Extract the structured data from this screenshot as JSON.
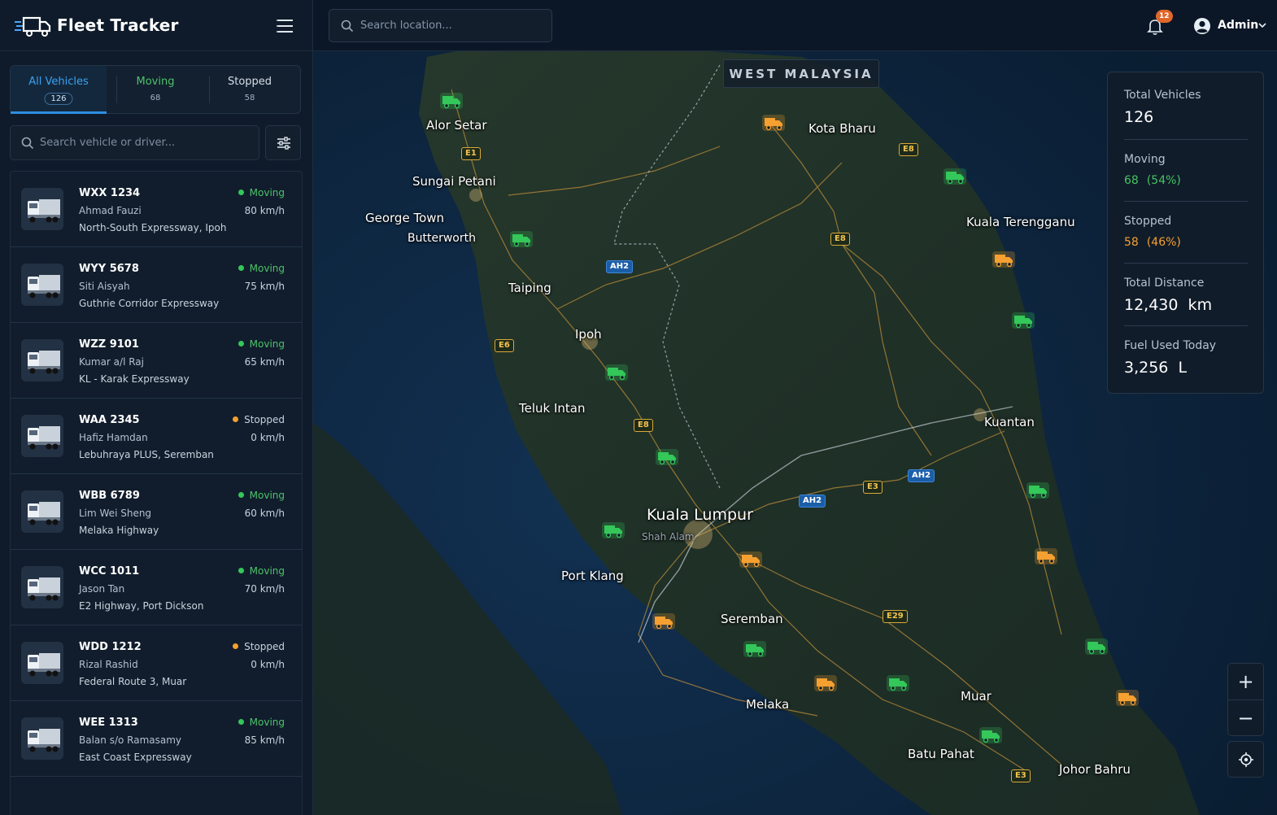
{
  "app": {
    "title": "Fleet Tracker"
  },
  "tabs": [
    {
      "label": "All Vehicles",
      "count": "126"
    },
    {
      "label": "Moving",
      "count": "68"
    },
    {
      "label": "Stopped",
      "count": "58"
    }
  ],
  "vehicle_search": {
    "placeholder": "Search vehicle or driver..."
  },
  "vehicles": [
    {
      "plate": "WXX 1234",
      "driver": "Ahmad Fauzi",
      "route": "North-South Expressway, Ipoh",
      "status": "Moving",
      "speed": "80 km/h"
    },
    {
      "plate": "WYY 5678",
      "driver": "Siti Aisyah",
      "route": "Guthrie Corridor Expressway",
      "status": "Moving",
      "speed": "75 km/h"
    },
    {
      "plate": "WZZ 9101",
      "driver": "Kumar a/l Raj",
      "route": "KL - Karak Expressway",
      "status": "Moving",
      "speed": "65 km/h"
    },
    {
      "plate": "WAA 2345",
      "driver": "Hafiz Hamdan",
      "route": "Lebuhraya PLUS, Seremban",
      "status": "Stopped",
      "speed": "0 km/h"
    },
    {
      "plate": "WBB 6789",
      "driver": "Lim Wei Sheng",
      "route": "Melaka Highway",
      "status": "Moving",
      "speed": "60 km/h"
    },
    {
      "plate": "WCC 1011",
      "driver": "Jason Tan",
      "route": "E2 Highway, Port Dickson",
      "status": "Moving",
      "speed": "70 km/h"
    },
    {
      "plate": "WDD 1212",
      "driver": "Rizal Rashid",
      "route": "Federal Route 3, Muar",
      "status": "Stopped",
      "speed": "0 km/h"
    },
    {
      "plate": "WEE 1313",
      "driver": "Balan s/o Ramasamy",
      "route": "East Coast Expressway",
      "status": "Moving",
      "speed": "85 km/h"
    }
  ],
  "topbar": {
    "location_search_placeholder": "Search location...",
    "notifications_count": "12",
    "user_name": "Admin"
  },
  "map": {
    "region_label": "WEST MALAYSIA",
    "cities": [
      "Alor Setar",
      "Sungai Petani",
      "George Town",
      "Butterworth",
      "Taiping",
      "Ipoh",
      "Teluk Intan",
      "Kota Bharu",
      "Kuala Terengganu",
      "Kuantan",
      "Kuala Lumpur",
      "Shah Alam",
      "Port Klang",
      "Seremban",
      "Melaka",
      "Muar",
      "Batu Pahat",
      "Johor Bahru"
    ],
    "roads": [
      "E1",
      "E8",
      "E8",
      "AH2",
      "E6",
      "E8",
      "AH2",
      "AH2",
      "E3",
      "E29",
      "E3"
    ],
    "status_colors": {
      "moving": "#34c759",
      "stopped": "#f5a030"
    }
  },
  "stats": {
    "total_vehicles_label": "Total Vehicles",
    "total_vehicles": "126",
    "moving_label": "Moving",
    "moving_value": "68",
    "moving_pct": "(54%)",
    "stopped_label": "Stopped",
    "stopped_value": "58",
    "stopped_pct": "(46%)",
    "distance_label": "Total Distance",
    "distance_value": "12,430  km",
    "fuel_label": "Fuel Used Today",
    "fuel_value": "3,256  L"
  },
  "controls": {
    "zoom_in": "+",
    "zoom_out": "−"
  }
}
